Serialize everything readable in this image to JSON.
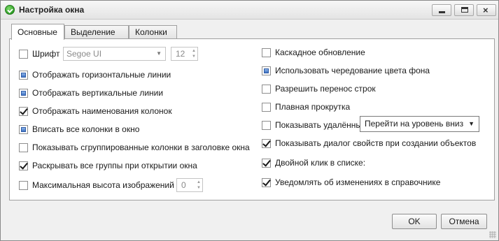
{
  "window": {
    "title": "Настройка окна",
    "icon": "app-logo-icon",
    "controls": {
      "minimize": "minimize-icon",
      "maximize": "maximize-icon",
      "close_glyph": "×"
    }
  },
  "tabs": [
    {
      "label": "Основные",
      "active": true
    },
    {
      "label": "Выделение",
      "active": false
    },
    {
      "label": "Колонки",
      "active": false
    }
  ],
  "left_options": {
    "font": {
      "label": "Шрифт",
      "checked": false,
      "font_value": "Segoe UI",
      "size_value": "12"
    },
    "horizontal_lines": {
      "label": "Отображать горизонтальные линии",
      "state": "indeterminate"
    },
    "vertical_lines": {
      "label": "Отображать вертикальные линии",
      "state": "indeterminate"
    },
    "column_names": {
      "label": "Отображать наименования колонок",
      "state": "checked"
    },
    "fit_columns": {
      "label": "Вписать все колонки в окно",
      "state": "indeterminate"
    },
    "grouped_in_header": {
      "label": "Показывать сгруппированные колонки в заголовке окна",
      "state": "unchecked"
    },
    "expand_groups": {
      "label": "Раскрывать все группы при открытии окна",
      "state": "checked"
    },
    "max_image_height": {
      "label": "Максимальная высота изображений",
      "state": "unchecked",
      "value": "0"
    }
  },
  "right_options": {
    "cascade_update": {
      "label": "Каскадное обновление",
      "state": "unchecked"
    },
    "alternate_bg": {
      "label": "Использовать чередование цвета фона",
      "state": "indeterminate"
    },
    "word_wrap": {
      "label": "Разрешить перенос строк",
      "state": "unchecked"
    },
    "smooth_scroll": {
      "label": "Плавная прокрутка",
      "state": "unchecked"
    },
    "show_deleted": {
      "label": "Показывать удалённые объекты",
      "state": "unchecked"
    },
    "props_dialog": {
      "label": "Показывать диалог свойств при создании объектов",
      "state": "checked"
    },
    "double_click": {
      "label": "Двойной клик в списке:",
      "state": "checked",
      "selected": "Перейти на уровень вниз"
    },
    "notify_changes": {
      "label": "Уведомлять об изменениях в справочнике",
      "state": "checked"
    }
  },
  "buttons": {
    "ok": "OK",
    "cancel": "Отмена"
  }
}
